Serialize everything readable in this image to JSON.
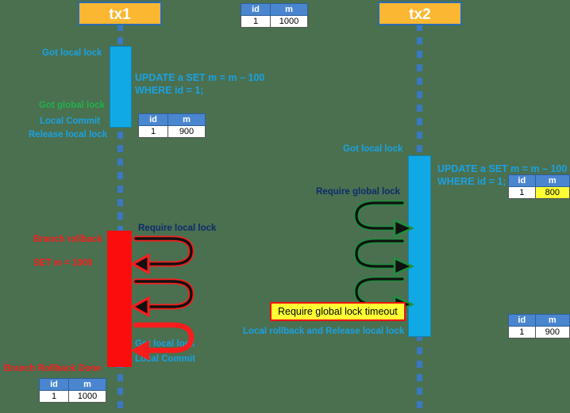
{
  "diagram": {
    "title_tx1": "tx1",
    "title_tx2": "tx2"
  },
  "colors": {
    "background": "#4a7050",
    "header_fill": "#fbb731",
    "header_border": "#2b6cb0",
    "bar_blue": "#10a9e6",
    "bar_red": "#fb0d0d",
    "lifeline": "#3a78c2",
    "label_cyan": "#1ba1e2",
    "label_green": "#22b14c",
    "label_red": "#f91c1c",
    "label_navy": "#0f2b6b",
    "table_header": "#4a86d0",
    "highlight": "#ffff33",
    "timeout_border": "#ee1111",
    "arrow_black": "#111111",
    "arrow_red": "#f91c1c",
    "arrow_green": "#1f8f3d"
  },
  "tables": {
    "initial": {
      "headers": [
        "id",
        "m"
      ],
      "rows": [
        [
          "1",
          "1000"
        ]
      ],
      "highlight_col": -1
    },
    "tx1_after_update": {
      "headers": [
        "id",
        "m"
      ],
      "rows": [
        [
          "1",
          "900"
        ]
      ],
      "highlight_col": -1
    },
    "tx1_after_rollback": {
      "headers": [
        "id",
        "m"
      ],
      "rows": [
        [
          "1",
          "1000"
        ]
      ],
      "highlight_col": -1
    },
    "tx2_after_update": {
      "headers": [
        "id",
        "m"
      ],
      "rows": [
        [
          "1",
          "800"
        ]
      ],
      "highlight_col": 1
    },
    "tx2_final": {
      "headers": [
        "id",
        "m"
      ],
      "rows": [
        [
          "1",
          "900"
        ]
      ],
      "highlight_col": -1
    }
  },
  "tx1": {
    "labels": {
      "got_local_lock": "Got local lock",
      "got_global_lock": "Got global lock",
      "local_commit": "Local Commit",
      "release_local_lock": "Release local lock",
      "branch_rollback": "Branch rollback",
      "set_m": "SET m = 1000",
      "branch_rollback_done": "Branch Rollback Done",
      "require_local_lock": "Require local lock",
      "got_local_lock_2": "Got local lock",
      "local_commit_2": "Local Commit"
    },
    "sql": "UPDATE a SET m = m – 100\nWHERE id = 1;"
  },
  "tx2": {
    "labels": {
      "got_local_lock": "Got local lock",
      "require_global_lock": "Require global lock",
      "timeout": "Require global lock timeout",
      "local_rollback": "Local rollback and Release local lock"
    },
    "sql": "UPDATE a SET m = m – 100\nWHERE id = 1;"
  }
}
